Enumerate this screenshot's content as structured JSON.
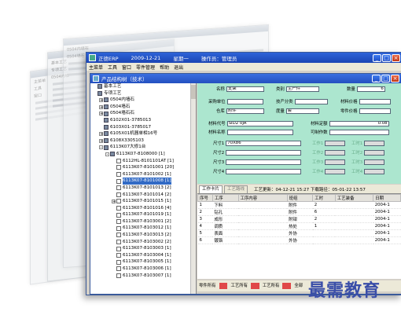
{
  "ghost_windows": {
    "g1_lines": [
      "主菜单",
      "工具",
      "窗口"
    ],
    "g2_lines": [
      "基本工艺",
      "专项工艺",
      "0504内墙"
    ],
    "g3_lines": [
      "0504内墙石",
      "0504墙石"
    ]
  },
  "window": {
    "app_name": "正德ERP",
    "date": "2009-12-21",
    "weekday": "星期一",
    "operator": "操作员：管理员",
    "menu": [
      "主菜单",
      "工具",
      "窗口",
      "零件管理",
      "帮助",
      "退出"
    ]
  },
  "child": {
    "title": "产品结构树（技术）"
  },
  "tree": {
    "items": [
      {
        "label": "基本工艺",
        "indent": 0,
        "exp": "",
        "icon": "folder"
      },
      {
        "label": "专项工艺",
        "indent": 0,
        "exp": "",
        "icon": "folder"
      },
      {
        "label": "0504内墙石",
        "indent": 1,
        "exp": "+",
        "icon": "folder"
      },
      {
        "label": "0504墙石",
        "indent": 1,
        "exp": "+",
        "icon": "folder"
      },
      {
        "label": "0504墙石石",
        "indent": 1,
        "exp": "+",
        "icon": "folder"
      },
      {
        "label": "6102X01-3785013",
        "indent": 1,
        "exp": "",
        "icon": "folder"
      },
      {
        "label": "6103X01-3785017",
        "indent": 1,
        "exp": "",
        "icon": "folder"
      },
      {
        "label": "6105X01机器单相16号",
        "indent": 1,
        "exp": "+",
        "icon": "folder"
      },
      {
        "label": "6108X3305103",
        "indent": 1,
        "exp": "+",
        "icon": "folder"
      },
      {
        "label": "6113K07大修1台",
        "indent": 1,
        "exp": "-",
        "icon": "folder"
      },
      {
        "label": "6113K07-8108000 [1]",
        "indent": 2,
        "exp": "-",
        "icon": "folder"
      },
      {
        "label": "6112HL-8101101AT [1]",
        "indent": 3,
        "exp": "",
        "icon": "doc"
      },
      {
        "label": "6113K07-8101001 [20]",
        "indent": 3,
        "exp": "",
        "icon": "doc"
      },
      {
        "label": "6113K07-8101002 [1]",
        "indent": 3,
        "exp": "",
        "icon": "doc"
      },
      {
        "label": "6113K07-8101008 [1]",
        "indent": 3,
        "exp": "",
        "icon": "doc",
        "selected": true
      },
      {
        "label": "6113K07-8101013 [2]",
        "indent": 3,
        "exp": "",
        "icon": "doc"
      },
      {
        "label": "6113K07-8101014 [2]",
        "indent": 3,
        "exp": "",
        "icon": "doc"
      },
      {
        "label": "6113K07-8101015 [1]",
        "indent": 3,
        "exp": "+",
        "icon": "doc"
      },
      {
        "label": "6113K07-8101016 [4]",
        "indent": 3,
        "exp": "",
        "icon": "doc"
      },
      {
        "label": "6113K07-8101019 [1]",
        "indent": 3,
        "exp": "",
        "icon": "doc"
      },
      {
        "label": "6113K07-8103001 [2]",
        "indent": 3,
        "exp": "",
        "icon": "doc"
      },
      {
        "label": "6113K07-8103012 [1]",
        "indent": 3,
        "exp": "",
        "icon": "doc"
      },
      {
        "label": "6113K07-8103013 [2]",
        "indent": 3,
        "exp": "",
        "icon": "doc"
      },
      {
        "label": "6113K07-8103002 [2]",
        "indent": 3,
        "exp": "",
        "icon": "doc"
      },
      {
        "label": "6113K07-8103003 [1]",
        "indent": 3,
        "exp": "",
        "icon": "doc"
      },
      {
        "label": "6113K07-8103004 [1]",
        "indent": 3,
        "exp": "",
        "icon": "doc"
      },
      {
        "label": "6113K07-8103005 [1]",
        "indent": 3,
        "exp": "",
        "icon": "doc"
      },
      {
        "label": "6113K07-8103006 [1]",
        "indent": 3,
        "exp": "",
        "icon": "doc"
      },
      {
        "label": "6113K07-8103007 [1]",
        "indent": 3,
        "exp": "",
        "icon": "doc"
      }
    ]
  },
  "form": {
    "name_label": "名称",
    "name_value": "支架",
    "category_label": "类别",
    "category_value": "生产件",
    "qty_label": "数量",
    "qty_value": "6",
    "unit_label": "采购单位",
    "unit_value": "",
    "class_label": "技产分类",
    "class_value": "",
    "material_price_label": "材料价格",
    "material_price_value": "",
    "warehouse_label": "仓库",
    "warehouse_value": "附件",
    "qty_unit_label": "度量",
    "qty_unit_value": "套",
    "part_price_label": "零件价格",
    "part_price_value": "",
    "mat_code_label": "材料代号",
    "mat_code_value": "SID2 0JA",
    "mat_quota_label": "材料定额",
    "mat_quota_value": "0.08",
    "mat_name_label": "材料名称",
    "mat_name_value": "",
    "mat_spec_label": "可制作数",
    "mat_spec_value": "",
    "size1_label": "尺寸1",
    "size1_value": "70X86",
    "size2_label": "尺寸2",
    "size2_value": "",
    "size3_label": "尺寸3",
    "size3_value": "",
    "size4_label": "尺寸4",
    "size4_value": "",
    "hour_labels": [
      "工作1",
      "工作2",
      "工作3",
      "工作4",
      "工时1",
      "工时2",
      "工时3",
      "工时4"
    ]
  },
  "tabs": {
    "tab1": "工作卡片",
    "tab2": "工艺路线",
    "info": "工艺更新：04-12-21 15:27   下载路径：05-01-22 13:57"
  },
  "grid": {
    "headers": [
      "序号",
      "工序",
      "工序内容",
      "班组",
      "工时",
      "工艺装备",
      "日期"
    ],
    "rows": [
      [
        "1",
        "下料",
        "",
        "附件",
        "2",
        "",
        "2004-1"
      ],
      [
        "2",
        "钻孔",
        "",
        "附件",
        "6",
        "",
        "2004-1"
      ],
      [
        "3",
        "成形",
        "",
        "附钳",
        "2",
        "",
        "2004-1"
      ],
      [
        "4",
        "调质",
        "",
        "热处",
        "1",
        "",
        "2004-1"
      ],
      [
        "5",
        "表面",
        "",
        "外协",
        "",
        "",
        "2004-1"
      ],
      [
        "6",
        "镀铬",
        "",
        "外协",
        "",
        "",
        "2004-1"
      ]
    ]
  },
  "bottom": {
    "items": [
      "零件所有",
      "工艺所有",
      "工艺所有",
      "全部"
    ]
  },
  "watermark": "最需教育",
  "colors": {
    "form_bg": "#ace6cf",
    "titlebar": "#1b45b4",
    "selection": "#316ac5",
    "tag_red": "#e04848"
  }
}
